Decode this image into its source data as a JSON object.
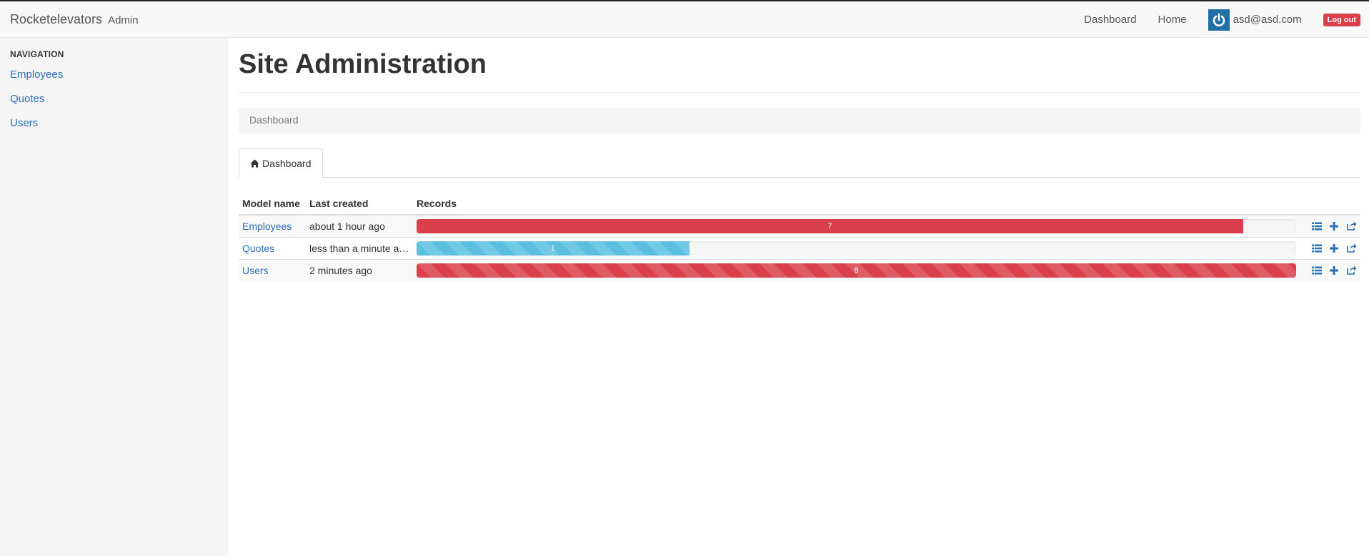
{
  "header": {
    "brand": "Rocketelevators",
    "brand_small": "Admin",
    "nav": {
      "dashboard": "Dashboard",
      "home": "Home"
    },
    "user_email": "asd@asd.com",
    "logout_label": "Log out"
  },
  "sidebar": {
    "heading": "NAVIGATION",
    "items": [
      {
        "label": "Employees"
      },
      {
        "label": "Quotes"
      },
      {
        "label": "Users"
      }
    ]
  },
  "main": {
    "title": "Site Administration",
    "breadcrumb": "Dashboard",
    "tab_label": "Dashboard",
    "table": {
      "headers": [
        "Model name",
        "Last created",
        "Records"
      ],
      "rows": [
        {
          "model": "Employees",
          "last_created": "about 1 hour ago",
          "records": "7",
          "fill_pct": 94,
          "bar_color": "#d9404c",
          "striped": false
        },
        {
          "model": "Quotes",
          "last_created": "less than a minute ago",
          "records": "1",
          "fill_pct": 31,
          "bar_color": "#5bc0de",
          "striped": true
        },
        {
          "model": "Users",
          "last_created": "2 minutes ago",
          "records": "8",
          "fill_pct": 100,
          "bar_color": "#d9404c",
          "striped": true
        }
      ]
    }
  },
  "icons": {
    "avatar": "power-icon",
    "tab": "home-icon",
    "actions": [
      "list-icon",
      "plus-icon",
      "share-icon"
    ]
  },
  "colors": {
    "link": "#2c6fb7",
    "danger": "#d9404c",
    "info": "#5bc0de",
    "avatar_bg": "#1f6fa8"
  }
}
